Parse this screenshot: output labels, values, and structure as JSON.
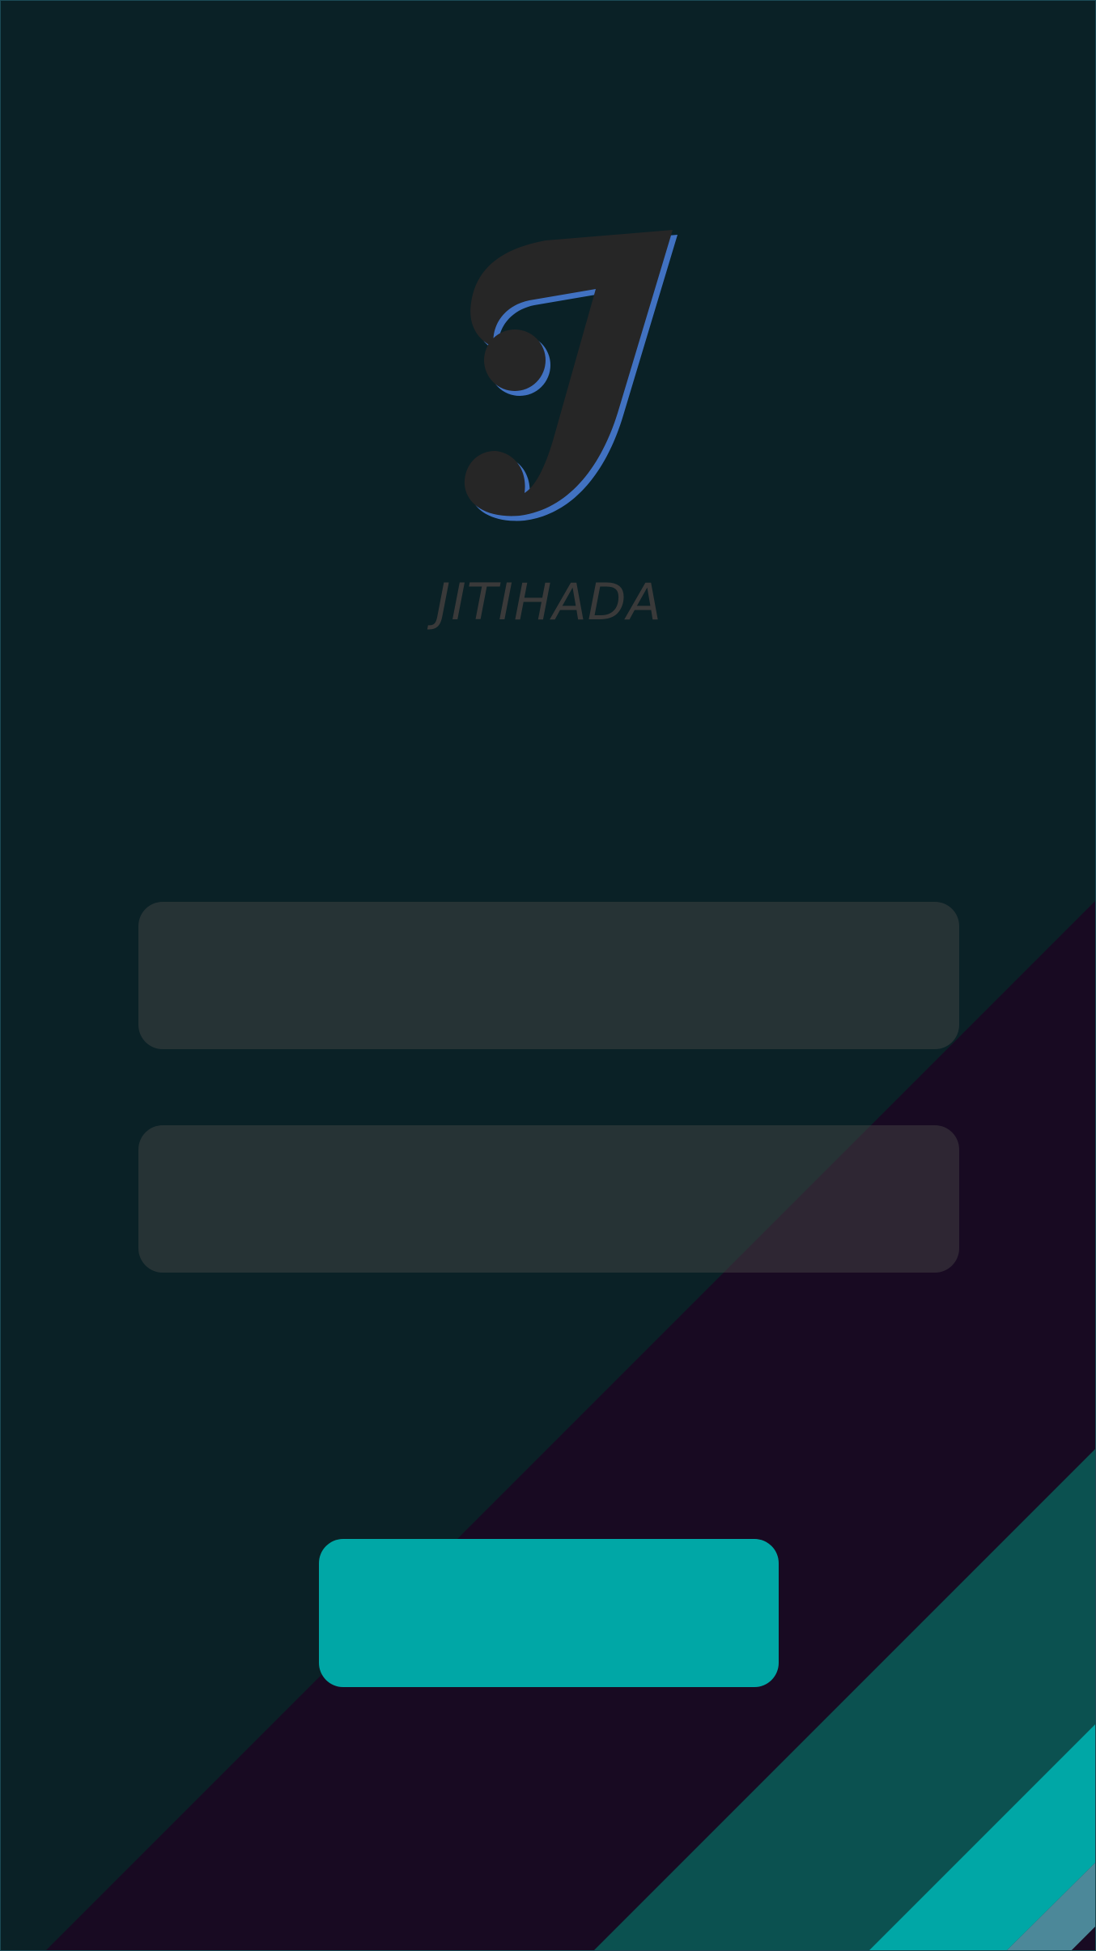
{
  "app": {
    "name": "JITIHADA",
    "logo_icon": "stylized-j-logo-icon"
  },
  "form": {
    "username": {
      "value": "",
      "placeholder": ""
    },
    "password": {
      "value": "",
      "placeholder": ""
    },
    "submit_label": ""
  },
  "colors": {
    "background": "#0a2126",
    "stripe_purple": "#180a22",
    "stripe_dark_teal": "#0b5150",
    "stripe_teal": "#00a7a6",
    "stripe_steel": "#4c8899",
    "field_fill": "#4a4a4a",
    "button": "#00a7a6",
    "logo_dark": "#262626",
    "logo_accent": "#4172c2",
    "title_text": "#3a3a3a"
  }
}
